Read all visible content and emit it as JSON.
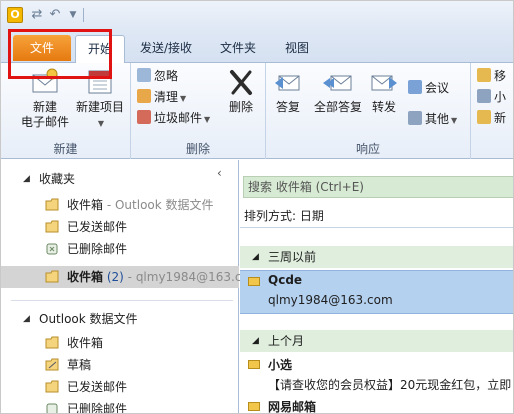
{
  "ribbon_tabs": {
    "file": "文件",
    "home": "开始",
    "send_receive": "发送/接收",
    "folder": "文件夹",
    "view": "视图"
  },
  "ribbon": {
    "new_group": {
      "label": "新建",
      "new_email_line1": "新建",
      "new_email_line2": "电子邮件",
      "new_items": "新建项目"
    },
    "delete_group": {
      "label": "删除",
      "ignore": "忽略",
      "clean_up": "清理",
      "junk": "垃圾邮件",
      "delete": "删除"
    },
    "respond_group": {
      "label": "响应",
      "reply": "答复",
      "reply_all": "全部答复",
      "forward": "转发",
      "meeting": "会议",
      "more": "其他"
    },
    "quick_steps_group": {
      "item1": "移",
      "item2": "小",
      "item3": "新"
    }
  },
  "nav": {
    "favorites_header": "收藏夹",
    "favorites": [
      {
        "name": "收件箱",
        "suffix": "- Outlook 数据文件"
      },
      {
        "name": "已发送邮件",
        "suffix": ""
      },
      {
        "name": "已删除邮件",
        "suffix": ""
      },
      {
        "name": "收件箱",
        "count": "(2)",
        "suffix": "- qlmy1984@163.c"
      }
    ],
    "data_file_header": "Outlook 数据文件",
    "data_file_folders": [
      "收件箱",
      "草稿",
      "已发送邮件",
      "已删除邮件"
    ]
  },
  "messages": {
    "search_placeholder": "搜索 收件箱 (Ctrl+E)",
    "sort_label": "排列方式: 日期",
    "groups": [
      {
        "label": "三周以前",
        "items": [
          {
            "sender": "Qcde",
            "line2": "qlmy1984@163.com"
          }
        ]
      },
      {
        "label": "上个月",
        "items": [
          {
            "sender": "小选",
            "line2": "【请查收您的会员权益】20元现金红包，立即"
          },
          {
            "sender": "网易邮箱",
            "line2": ""
          }
        ]
      }
    ]
  },
  "colors": {
    "file_tab": "#e57a10",
    "highlight": "#e01212",
    "selected_mail": "#b4d1ef",
    "search_bg": "#d7ead3"
  }
}
